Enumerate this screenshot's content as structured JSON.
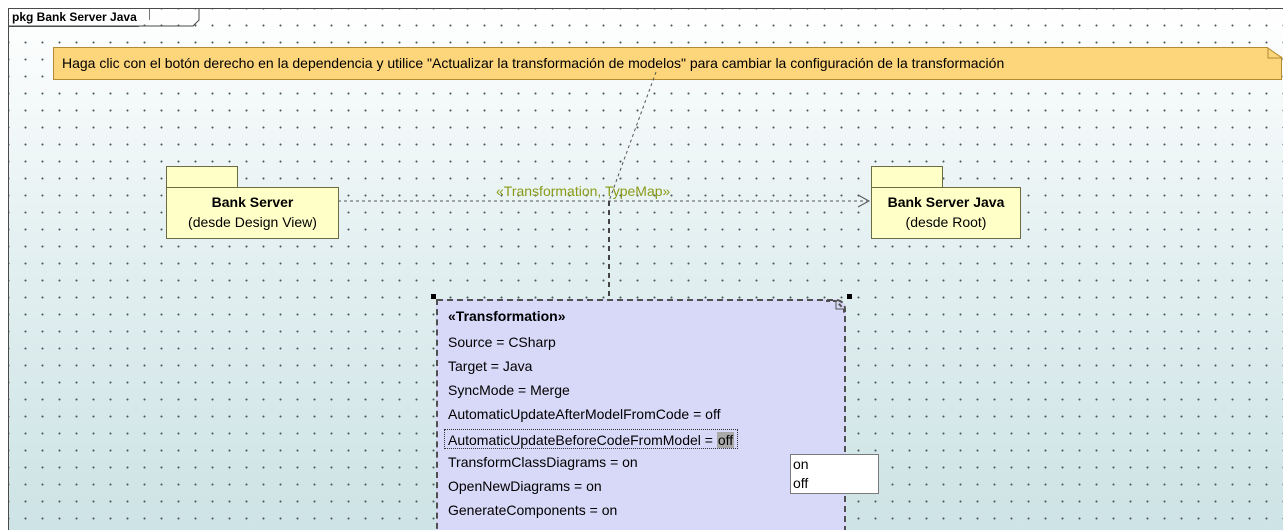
{
  "diagram": {
    "frame_title": "pkg Bank Server Java",
    "note_text": "Haga clic con el botón derecho en la dependencia y utilice \"Actualizar la transformación de modelos\" para cambiar la configuración de la transformación",
    "source_package": {
      "name": "Bank Server",
      "origin": "(desde Design View)"
    },
    "target_package": {
      "name": "Bank Server Java",
      "origin": "(desde Root)"
    },
    "dependency_stereotype": "«Transformation, TypeMap»",
    "transformation": {
      "stereotype": "«Transformation»",
      "rows": [
        "Source = CSharp",
        "Target = Java",
        "SyncMode = Merge",
        "AutomaticUpdateAfterModelFromCode = off"
      ],
      "selected_row": {
        "label": "AutomaticUpdateBeforeCodeFromModel = ",
        "value": "off"
      },
      "rows_after": [
        "TransformClassDiagrams = on",
        "OpenNewDiagrams = on",
        "GenerateComponents = on"
      ]
    },
    "value_dropdown": {
      "options": [
        "on",
        "off"
      ]
    },
    "colors": {
      "note_fill": "#fdd57b",
      "package_fill": "#ffffc8",
      "transformation_fill": "#d8d8f8",
      "stereotype_text": "#8a9a18"
    }
  }
}
